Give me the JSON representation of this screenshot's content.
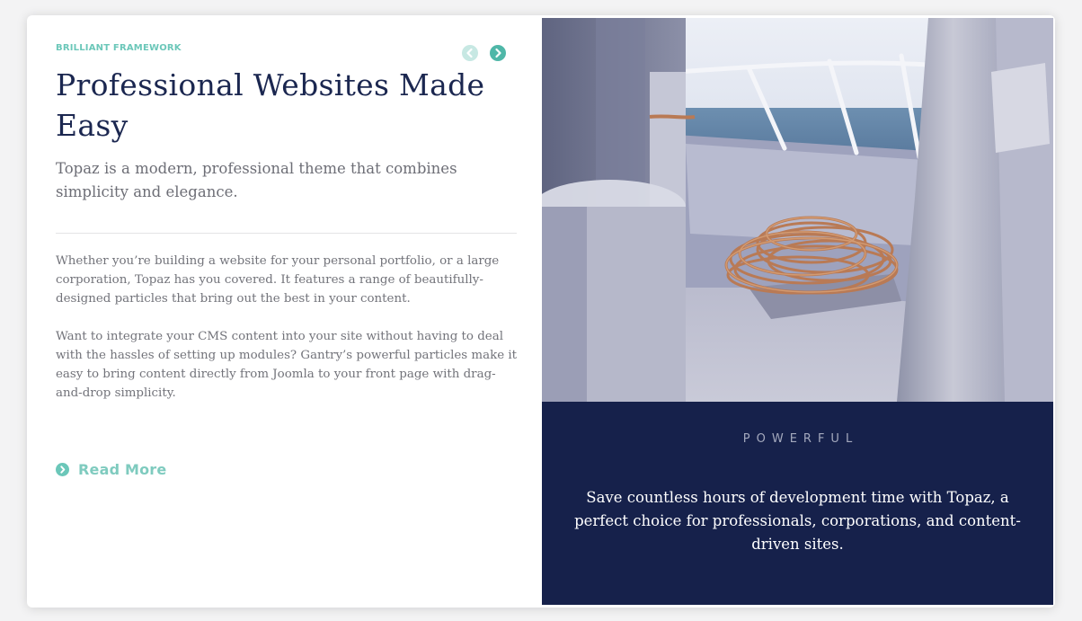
{
  "hero": {
    "eyebrow": "BRILLIANT FRAMEWORK",
    "title": "Professional Websites Made Easy",
    "lead": "Topaz is a modern, professional theme that combines simplicity and elegance.",
    "paragraphs": [
      "Whether you’re building a website for your personal portfolio, or a large corporation, Topaz has you covered. It features a range of beautifully-designed particles that bring out the best in your content.",
      "Want to integrate your CMS content into your site without having to deal with the hassles of setting up modules? Gantry’s powerful particles make it easy to bring content directly from Joomla to your front page with drag-and-drop simplicity."
    ],
    "read_more_label": "Read More",
    "prev_icon": "chevron-left-circle-icon",
    "next_icon": "chevron-right-circle-icon"
  },
  "feature": {
    "image_alt": "Coiled rope on the deck of a boat at sea",
    "label": "POWERFUL",
    "text": "Save countless hours of development time with Topaz, a perfect choice for professionals, corporations, and content-driven sites."
  },
  "colors": {
    "accent": "#6bc7b9",
    "navy": "#16214b",
    "title": "#1b2750"
  }
}
